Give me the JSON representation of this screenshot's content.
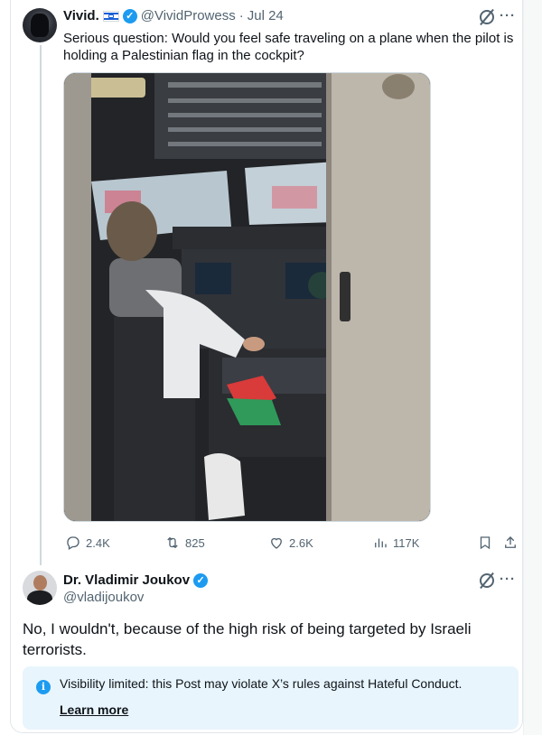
{
  "tweet": {
    "author_name": "Vivid.",
    "handle": "@VividProwess",
    "separator": "·",
    "date": "Jul 24",
    "text": "Serious question: Would you feel safe traveling on a plane when the pilot is holding a Palestinian flag in the cockpit?",
    "stats": {
      "replies": "2.4K",
      "reposts": "825",
      "likes": "2.6K",
      "views": "117K"
    }
  },
  "reply": {
    "author_name": "Dr. Vladimir Joukov",
    "handle": "@vladijoukov",
    "text": "No, I wouldn't, because of the high risk of being targeted by Israeli terrorists."
  },
  "notice": {
    "text": "Visibility limited: this Post may violate X’s rules against Hateful Conduct.",
    "link_label": "Learn more",
    "icon_glyph": "i"
  },
  "more_glyph": "···",
  "verified_glyph": "✓",
  "colors": {
    "accent": "#1d9bf0",
    "text": "#0f1419",
    "muted": "#536471",
    "notice_bg": "#e8f5fd"
  }
}
